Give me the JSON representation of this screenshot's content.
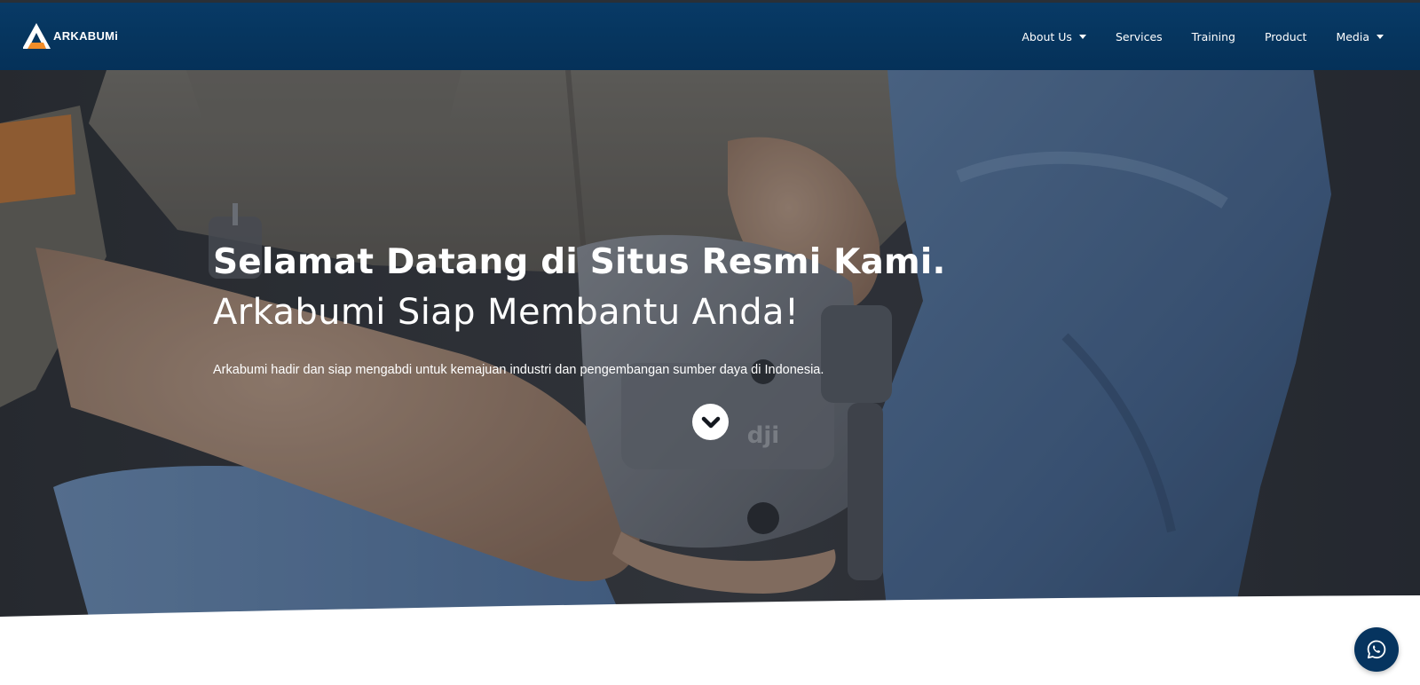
{
  "brand": {
    "name": "ARKABUMi"
  },
  "nav": {
    "items": [
      {
        "label": "About Us",
        "has_dropdown": true
      },
      {
        "label": "Services",
        "has_dropdown": false
      },
      {
        "label": "Training",
        "has_dropdown": false
      },
      {
        "label": "Product",
        "has_dropdown": false
      },
      {
        "label": "Media",
        "has_dropdown": true
      }
    ]
  },
  "hero": {
    "headline": "Selamat Datang di Situs Resmi Kami.",
    "subheadline": "Arkabumi Siap Membantu Anda!",
    "tagline": "Arkabumi hadir dan siap mengabdi untuk kemajuan industri dan pengembangan sumber daya di Indonesia.",
    "scroll_icon": "chevron-down-icon",
    "background_image": "drone-in-hands-photo"
  },
  "floating": {
    "whatsapp_icon": "whatsapp-icon"
  },
  "colors": {
    "navbar": "#06355e",
    "accent_orange": "#f28c28",
    "text_light": "#ffffff",
    "whatsapp_button": "#06345f"
  }
}
